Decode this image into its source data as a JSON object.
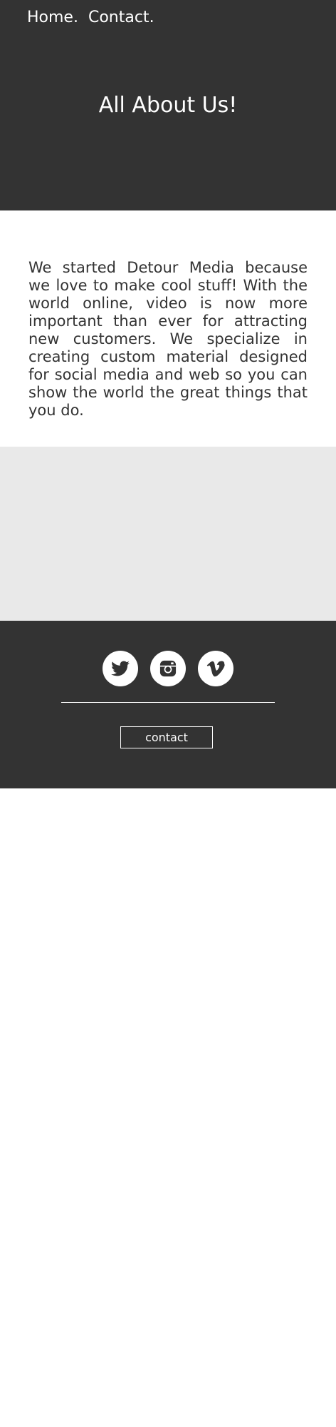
{
  "nav": {
    "home_label": "Home.",
    "contact_label": "Contact."
  },
  "hero": {
    "title": "All About Us!"
  },
  "about": {
    "text": "We started Detour Media because we love to make cool stuff! With the world online, video is now more important than ever for attracting new customers. We specialize in creating custom material designed for social media and web so you can show the world the great things that you do."
  },
  "footer": {
    "social_icons": [
      "twitter-icon",
      "instagram-icon",
      "vimeo-icon"
    ],
    "contact_button_label": "contact"
  },
  "colors": {
    "dark_background": "#333333",
    "light_band": "#e9e9e9",
    "text": "#333333",
    "on_dark": "#ffffff"
  }
}
